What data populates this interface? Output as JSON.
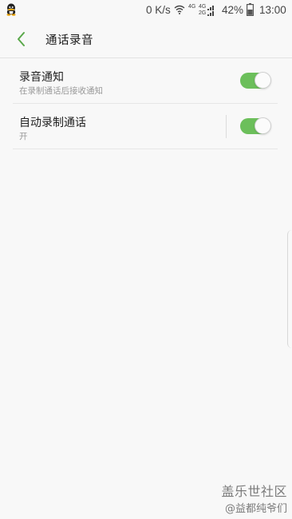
{
  "status_bar": {
    "net_speed": "0 K/s",
    "network_top": "4G",
    "network_mid": "4G",
    "network_bottom": "2G",
    "battery_percent": "42%",
    "time": "13:00",
    "icons": [
      "qq-icon",
      "wifi-icon",
      "signal-icon",
      "battery-icon"
    ]
  },
  "app_bar": {
    "title": "通话录音",
    "back_icon": "chevron-left-icon"
  },
  "settings": [
    {
      "title": "录音通知",
      "subtitle": "在录制通话后接收通知",
      "toggle_on": true
    },
    {
      "title": "自动录制通话",
      "subtitle": "开",
      "toggle_on": true
    }
  ],
  "watermark": {
    "brand": "盖乐世社区",
    "credit": "@益都纯爷们"
  },
  "colors": {
    "accent": "#6cbf5b",
    "background": "#f8f8f8",
    "divider": "#e6e6e6"
  }
}
